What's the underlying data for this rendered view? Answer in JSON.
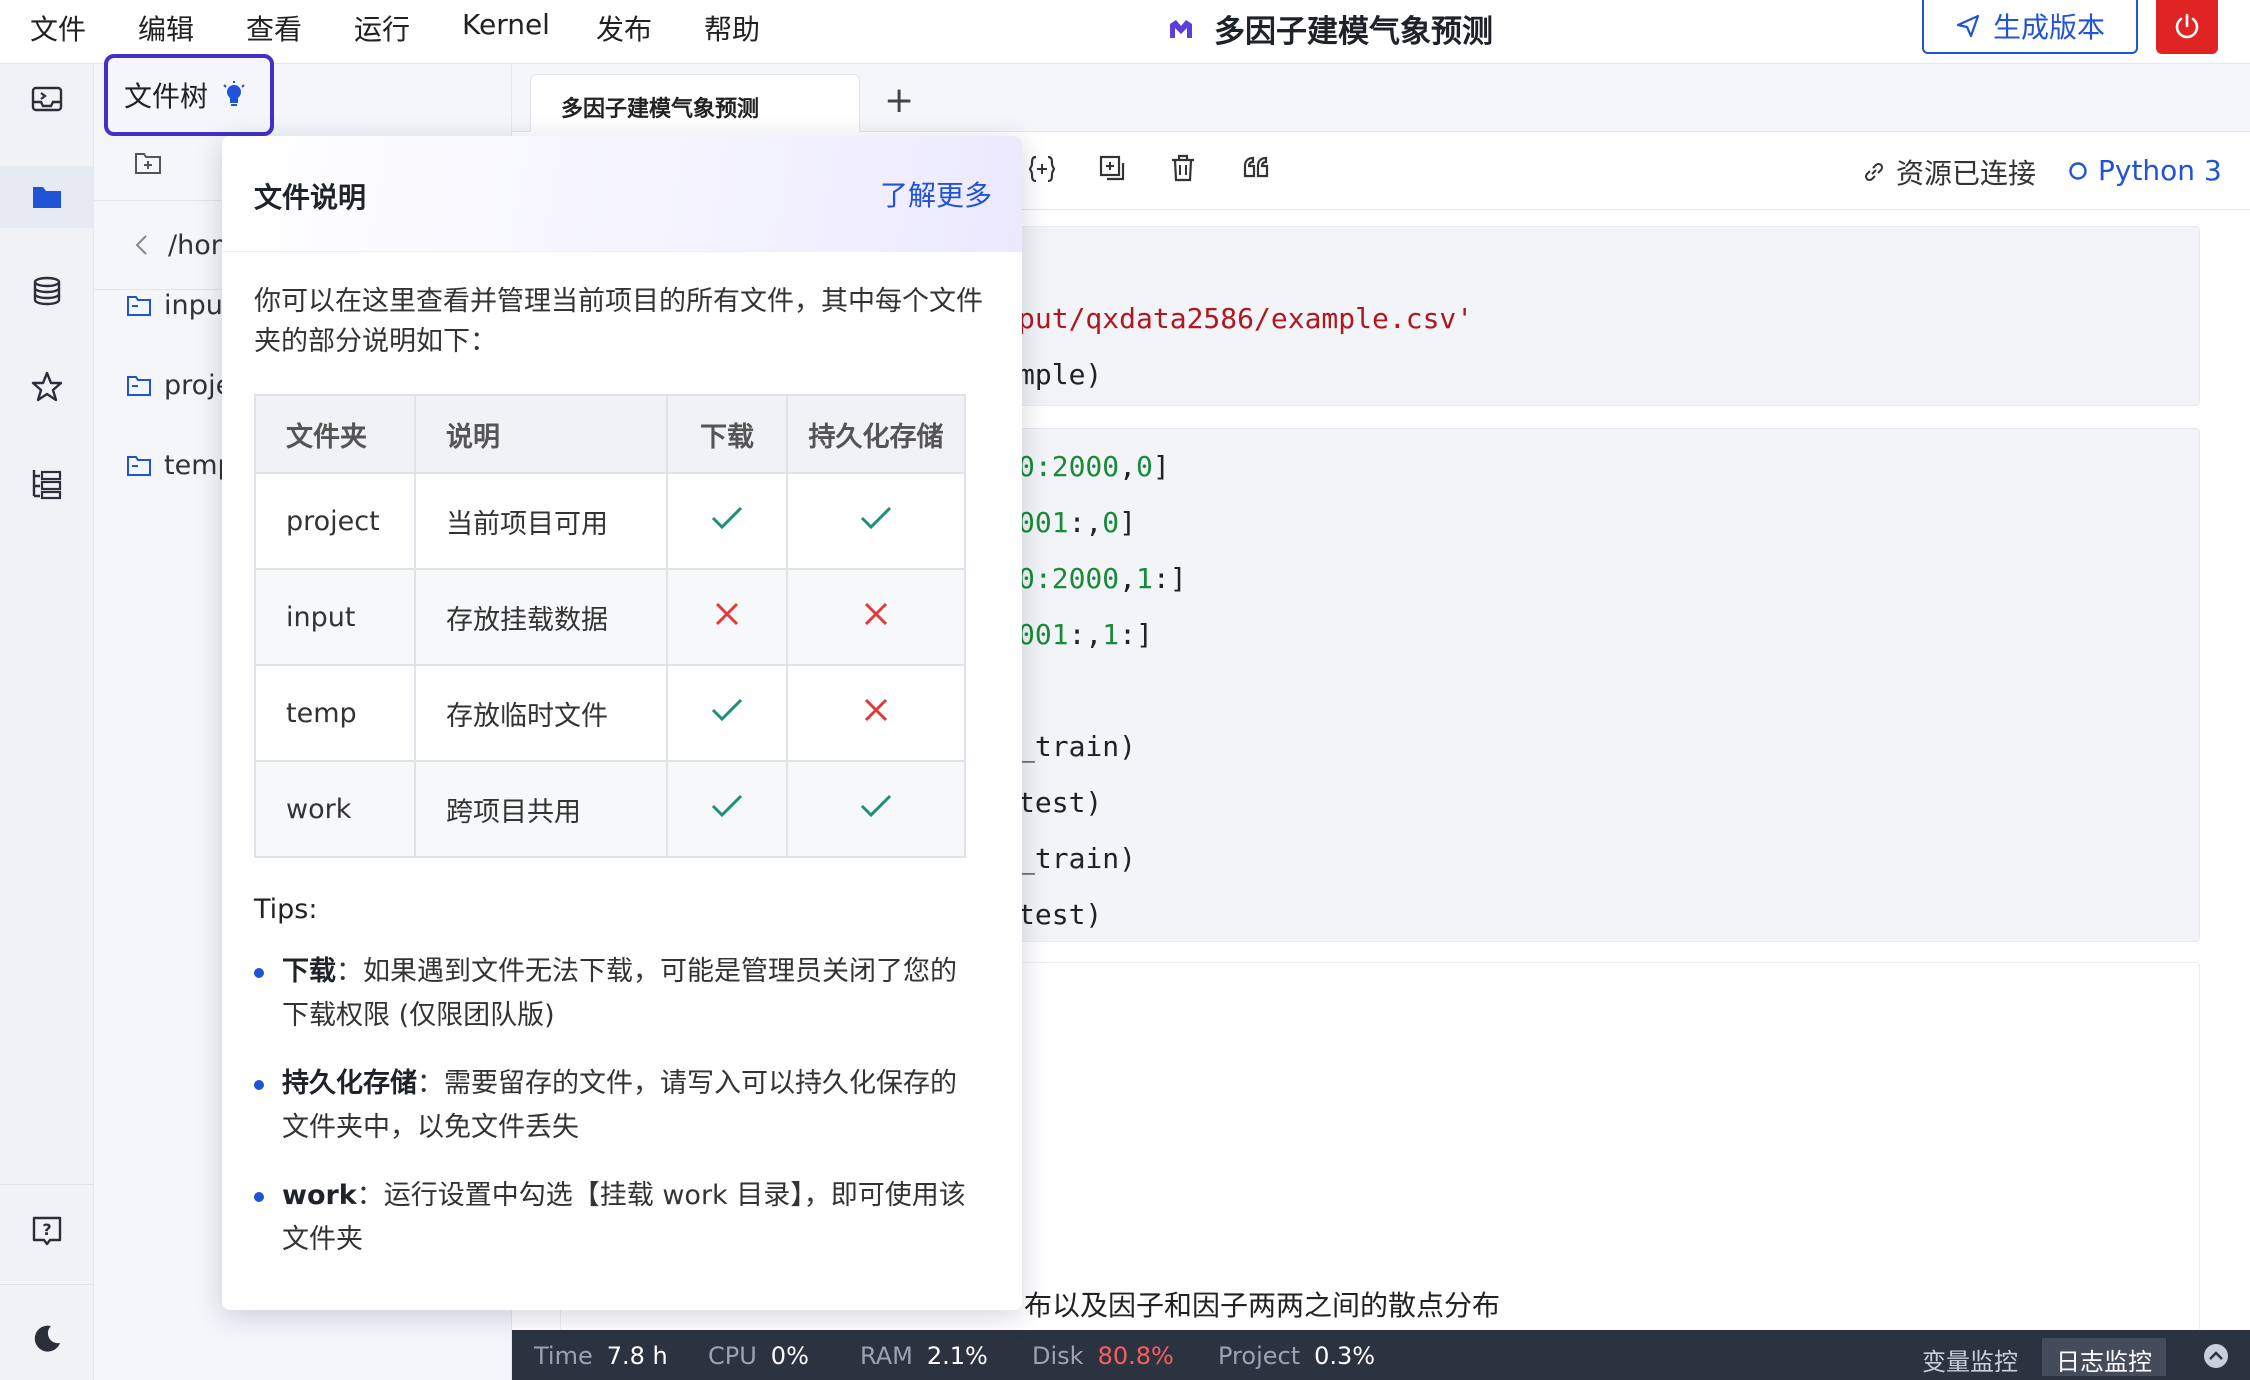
{
  "menubar": {
    "items": [
      "文件",
      "编辑",
      "查看",
      "运行",
      "Kernel",
      "发布",
      "帮助"
    ],
    "title": "多因子建模气象预测",
    "generate_btn": "生成版本"
  },
  "filepanel": {
    "tab_label": "文件树",
    "path": "/hom",
    "files": [
      "input",
      "proje",
      "temp"
    ]
  },
  "editor": {
    "tab_label": "多因子建模气象预测",
    "add_tab": "+",
    "resource_status": "资源已连接",
    "kernel": "Python 3",
    "code_lines": [
      {
        "text": "put/qxdata2586/example.csv'",
        "kind": "str"
      },
      {
        "text": "mple)",
        "kind": "plain"
      },
      {
        "pre": "0:",
        "n1": "2000",
        "mid": ",",
        "n2": "0",
        "post": "]"
      },
      {
        "pre": "",
        "n1": "001",
        "mid": ":,",
        "n2": "0",
        "post": "]"
      },
      {
        "pre": "0:",
        "n1": "2000",
        "mid": ",",
        "n2": "1",
        "post": ":]"
      },
      {
        "pre": "",
        "n1": "001",
        "mid": ":,",
        "n2": "1",
        "post": ":]"
      },
      {
        "text": "_train)",
        "kind": "plain"
      },
      {
        "text": "test)",
        "kind": "plain"
      },
      {
        "text": "_train)",
        "kind": "plain"
      },
      {
        "text": "test)",
        "kind": "plain"
      }
    ],
    "md_text": "布以及因子和因子两两之间的散点分布"
  },
  "statusbar": {
    "time_label": "Time",
    "time_value": "7.8 h",
    "cpu_label": "CPU",
    "cpu_value": "0%",
    "ram_label": "RAM",
    "ram_value": "2.1%",
    "disk_label": "Disk",
    "disk_value": "80.8%",
    "project_label": "Project",
    "project_value": "0.3%",
    "var_monitor": "变量监控",
    "log_monitor": "日志监控"
  },
  "popover": {
    "title": "文件说明",
    "learn_more": "了解更多",
    "description": "你可以在这里查看并管理当前项目的所有文件，其中每个文件夹的部分说明如下：",
    "table": {
      "headers": [
        "文件夹",
        "说明",
        "下载",
        "持久化存储"
      ],
      "rows": [
        {
          "folder": "project",
          "desc": "当前项目可用",
          "download": true,
          "persist": true
        },
        {
          "folder": "input",
          "desc": "存放挂载数据",
          "download": false,
          "persist": false
        },
        {
          "folder": "temp",
          "desc": "存放临时文件",
          "download": true,
          "persist": false
        },
        {
          "folder": "work",
          "desc": "跨项目共用",
          "download": true,
          "persist": true
        }
      ]
    },
    "tips_label": "Tips:",
    "tips": [
      {
        "key": "下载",
        "text": "：如果遇到文件无法下载，可能是管理员关闭了您的下载权限 (仅限团队版)"
      },
      {
        "key": "持久化存储",
        "text": "：需要留存的文件，请写入可以持久化保存的文件夹中，以免文件丢失"
      },
      {
        "key": "work",
        "text": "：运行设置中勾选【挂载 work 目录】，即可使用该文件夹"
      }
    ]
  },
  "colors": {
    "accent": "#2153d6",
    "danger": "#e02424",
    "check": "#1f8f7a",
    "cross": "#e03a3a",
    "highlight": "#4330c8"
  }
}
